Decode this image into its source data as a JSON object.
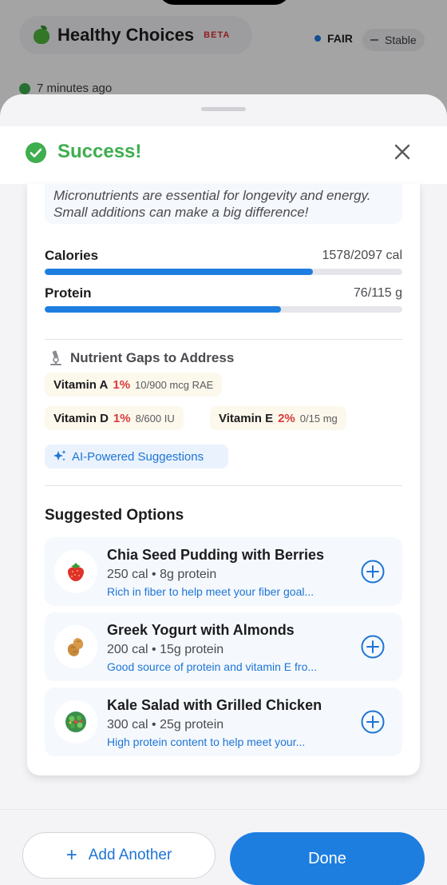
{
  "background": {
    "app_title": "Healthy Choices",
    "beta_badge": "BETA",
    "status_label": "FAIR",
    "trend_label": "Stable",
    "last_updated": "7 minutes ago"
  },
  "sheet": {
    "title": "Success!",
    "tip": "Micronutrients are essential for longevity and energy. Small additions can make a big difference!",
    "metrics": [
      {
        "label": "Calories",
        "value": "1578/2097 cal",
        "progress": 0.75
      },
      {
        "label": "Protein",
        "value": "76/115 g",
        "progress": 0.66
      }
    ],
    "gaps_title": "Nutrient Gaps to Address",
    "gaps": [
      {
        "name": "Vitamin A",
        "percent": "1%",
        "amount": "10/900 mcg RAE"
      },
      {
        "name": "Vitamin D",
        "percent": "1%",
        "amount": "8/600 IU"
      },
      {
        "name": "Vitamin E",
        "percent": "2%",
        "amount": "0/15 mg"
      }
    ],
    "ai_label": "AI-Powered Suggestions",
    "options_title": "Suggested Options",
    "options": [
      {
        "icon": "strawberry-icon",
        "name": "Chia Seed Pudding with Berries",
        "meta": "250 cal • 8g protein",
        "desc": "Rich in fiber to help meet your fiber goal..."
      },
      {
        "icon": "peanut-icon",
        "name": "Greek Yogurt with Almonds",
        "meta": "200 cal • 15g protein",
        "desc": "Good source of protein and vitamin E fro..."
      },
      {
        "icon": "salad-icon",
        "name": "Kale Salad with Grilled Chicken",
        "meta": "300 cal • 25g protein",
        "desc": "High protein content to help meet your..."
      }
    ]
  },
  "footer": {
    "add_another_label": "Add Another",
    "done_label": "Done"
  },
  "colors": {
    "accent": "#1e7ee0",
    "success": "#3fae4f",
    "warning_text": "#d93a3a"
  }
}
